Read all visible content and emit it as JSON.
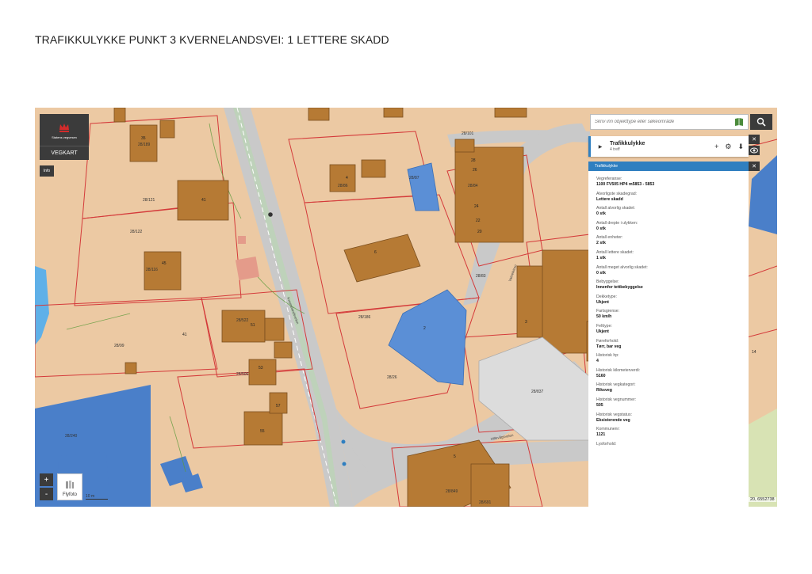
{
  "page": {
    "title": "TRAFIKKULYKKE PUNKT 3 KVERNELANDSVEI: 1 LETTERE SKADD"
  },
  "map": {
    "logo_text": "Statens vegvesen",
    "vegkart_label": "VEGKART",
    "info_label": "Info",
    "zoom_in": "+",
    "zoom_out": "-",
    "flyfoto_label": "Flyfoto",
    "scale_text": "10 m",
    "coord_readout": "20, 6552738",
    "colors": {
      "land": "#ecc9a3",
      "building": "#b67a34",
      "road": "#c9c9c9",
      "selected_building": "#5b8fd6",
      "property_line": "#d43a3a",
      "water": "#5fb0e8"
    },
    "parcel_labels": [
      "28/189",
      "28/121",
      "28/122",
      "28/116",
      "28/99",
      "28/522",
      "28/506",
      "28/240",
      "28/87",
      "28/86",
      "28/186",
      "28/26",
      "28/83",
      "28/837",
      "28/101",
      "28/84",
      "28/695",
      "28/849",
      "28/691"
    ],
    "building_numbers": [
      "35",
      "41",
      "45",
      "43",
      "41",
      "51",
      "53",
      "55",
      "57",
      "2",
      "6",
      "4",
      "3",
      "5",
      "14",
      "28",
      "26",
      "24",
      "22",
      "20",
      "18",
      "16"
    ],
    "road_names": [
      "Kvernelandsveien",
      "Hillevågsveien",
      "Vatneleiren"
    ]
  },
  "search": {
    "placeholder": "Skriv inn objekttype eller søkeområde"
  },
  "results": {
    "title": "Trafikkulykke",
    "count": "4 treff",
    "tools": {
      "add": "+",
      "settings": "⚙",
      "download": "⬇"
    },
    "close": "✕"
  },
  "detail": {
    "header": "Trafikkulykke",
    "close": "✕",
    "properties": [
      {
        "label": "Vegreferanse:",
        "value": "1100 FV505 HP4 m5853 - 5853"
      },
      {
        "label": "Alvorligste skadegrad:",
        "value": "Lettere skadd"
      },
      {
        "label": "Antall alvorlig skadet:",
        "value": "0 stk"
      },
      {
        "label": "Antall drepte i ulykken:",
        "value": "0 stk"
      },
      {
        "label": "Antall enheter:",
        "value": "2 stk"
      },
      {
        "label": "Antall lettere skadet:",
        "value": "1 stk"
      },
      {
        "label": "Antall meget alvorlig skadet:",
        "value": "0 stk"
      },
      {
        "label": "Bebyggelse:",
        "value": "Innenfor tettbebyggelse"
      },
      {
        "label": "Dekketype:",
        "value": "Ukjent"
      },
      {
        "label": "Fartsgrense:",
        "value": "50 km/h"
      },
      {
        "label": "Felttype:",
        "value": "Ukjent"
      },
      {
        "label": "Føreforhold:",
        "value": "Tørr, bar veg"
      },
      {
        "label": "Historisk hp:",
        "value": "4"
      },
      {
        "label": "Historisk kilometerverdi:",
        "value": "5160"
      },
      {
        "label": "Historisk vegkategori:",
        "value": "Riksveg"
      },
      {
        "label": "Historisk vegnummer:",
        "value": "505"
      },
      {
        "label": "Historisk vegstatus:",
        "value": "Eksisterende veg"
      },
      {
        "label": "Kommunenr:",
        "value": "1121"
      },
      {
        "label": "Lysforhold:",
        "value": ""
      }
    ]
  }
}
